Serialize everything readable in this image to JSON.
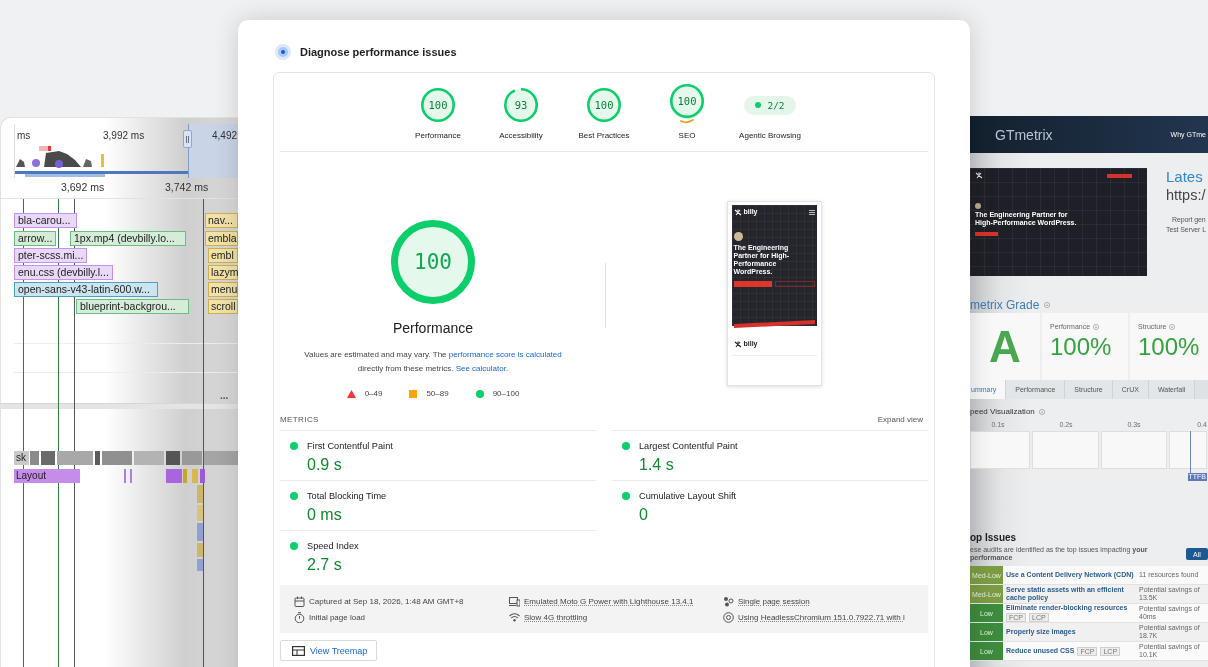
{
  "trace_panel": {
    "overview_ticks": [
      "ms",
      "3,992 ms",
      "4,492"
    ],
    "ruler_ticks": [
      "3,692 ms",
      "3,742 ms"
    ],
    "requests": [
      {
        "label": "bla-carou...",
        "kind": "stylesheet"
      },
      {
        "label": "nav...",
        "kind": "script"
      },
      {
        "label": "arrow...",
        "kind": "image"
      },
      {
        "label": "1px.mp4 (devbilly.lo...",
        "kind": "image"
      },
      {
        "label": "embla",
        "kind": "script"
      },
      {
        "label": "pter-scss.mi...",
        "kind": "stylesheet"
      },
      {
        "label": "embl",
        "kind": "script"
      },
      {
        "label": "enu.css (devbilly.l...",
        "kind": "stylesheet"
      },
      {
        "label": "lazym",
        "kind": "script"
      },
      {
        "label": "open-sans-v43-latin-600.w...",
        "kind": "font"
      },
      {
        "label": "menu",
        "kind": "script"
      },
      {
        "label": "blueprint-backgrou...",
        "kind": "image"
      },
      {
        "label": "scroll",
        "kind": "script"
      }
    ],
    "collapse_label": "...",
    "tracks": [
      {
        "label": "sk",
        "kind": "task"
      },
      {
        "label": "Layout",
        "kind": "layout"
      }
    ]
  },
  "diagnose": {
    "title": "Diagnose performance issues",
    "categories": [
      {
        "label": "Performance",
        "score": "100",
        "level": 1,
        "selected": false
      },
      {
        "label": "Accessibility",
        "score": "93",
        "level": 0.93,
        "selected": false
      },
      {
        "label": "Best Practices",
        "score": "100",
        "level": 1,
        "selected": false
      },
      {
        "label": "SEO",
        "score": "100",
        "level": 1,
        "selected": true
      }
    ],
    "agentic": {
      "label": "Agentic Browsing",
      "value": "2/2"
    },
    "summary": {
      "score": "100",
      "level": 1,
      "title": "Performance",
      "description": [
        {
          "kind": "text",
          "text": "Values are estimated and may vary. The "
        },
        {
          "kind": "link",
          "text": "performance score is calculated"
        },
        {
          "kind": "text",
          "text": " directly from these metrics. "
        },
        {
          "kind": "link",
          "text": "See calculator."
        }
      ],
      "legend": [
        {
          "kind": "fail",
          "label": "0–49"
        },
        {
          "kind": "average",
          "label": "50–89"
        },
        {
          "kind": "pass",
          "label": "90–100"
        }
      ]
    },
    "screenshot": {
      "logo": "billy",
      "headline": "The Engineering Partner for High-Performance WordPress.",
      "footer_logo": "billy"
    },
    "metrics": {
      "heading": "METRICS",
      "toggle": "Expand view",
      "items": [
        {
          "label": "First Contentful Paint",
          "value": "0.9 s"
        },
        {
          "label": "Largest Contentful Paint",
          "value": "1.4 s"
        },
        {
          "label": "Total Blocking Time",
          "value": "0 ms"
        },
        {
          "label": "Cumulative Layout Shift",
          "value": "0"
        },
        {
          "label": "Speed Index",
          "value": "2.7 s"
        }
      ]
    },
    "environment": [
      {
        "kind": "calendar",
        "text": "Captured at Sep 18, 2026, 1:48 AM GMT+8",
        "underlined": false
      },
      {
        "kind": "device",
        "text": "Emulated Moto G Power with Lighthouse 13.4.1",
        "underlined": true
      },
      {
        "kind": "session",
        "text": "Single page session",
        "underlined": true
      },
      {
        "kind": "timer",
        "text": "Initial page load",
        "underlined": false
      },
      {
        "kind": "network",
        "text": "Slow 4G throttling",
        "underlined": true
      },
      {
        "kind": "browser",
        "text": "Using HeadlessChromium 151.0.7922.71 with l",
        "underlined": true
      }
    ],
    "treemap_button": "View Treemap"
  },
  "gtmetrix": {
    "logo": "GTmetrix",
    "nav_link": "Why GTme",
    "site_headline": "The Engineering Partner for High-Performance WordPress.",
    "report_title": "Lates",
    "report_url": "https:/",
    "report_meta": [
      "Report gen",
      "Test Server L"
    ],
    "grade_heading": "metrix Grade",
    "grade": "A",
    "scores": [
      {
        "label": "Performance",
        "value": "100%"
      },
      {
        "label": "Structure",
        "value": "100%"
      }
    ],
    "tabs": [
      {
        "label": "ummary",
        "selected": true
      },
      {
        "label": "Performance",
        "selected": false
      },
      {
        "label": "Structure",
        "selected": false
      },
      {
        "label": "CrUX",
        "selected": false
      },
      {
        "label": "Waterfall",
        "selected": false
      }
    ],
    "speed_heading": "peed Visualization",
    "speed_ticks": [
      "0.1s",
      "0.2s",
      "0.3s",
      "0.4"
    ],
    "ttfb_label": "TTFB",
    "issues_heading": "op Issues",
    "issues_intro": "ese audits are identified as the top issues impacting **your performance**",
    "filter_button": "All",
    "issues": [
      {
        "severity": "Med-Low",
        "color": "#7c9c44",
        "title": "Use a Content Delivery Network (CDN)",
        "detail": "11 resources found"
      },
      {
        "severity": "Med-Low",
        "color": "#7c9c44",
        "title": "Serve static assets with an efficient cache policy",
        "detail": "Potential savings of 13.5K"
      },
      {
        "severity": "Low",
        "color": "#3d8b3d",
        "title": "Eliminate render-blocking resources",
        "tags": [
          "FCP",
          "LCP"
        ],
        "detail": "Potential savings of 40ms"
      },
      {
        "severity": "Low",
        "color": "#3d8b3d",
        "title": "Properly size images",
        "detail": "Potential savings of 18.7K"
      },
      {
        "severity": "Low",
        "color": "#3d8b3d",
        "title": "Reduce unused CSS",
        "tags": [
          "FCP",
          "LCP"
        ],
        "detail": "Potential savings of 10.1K"
      }
    ]
  }
}
